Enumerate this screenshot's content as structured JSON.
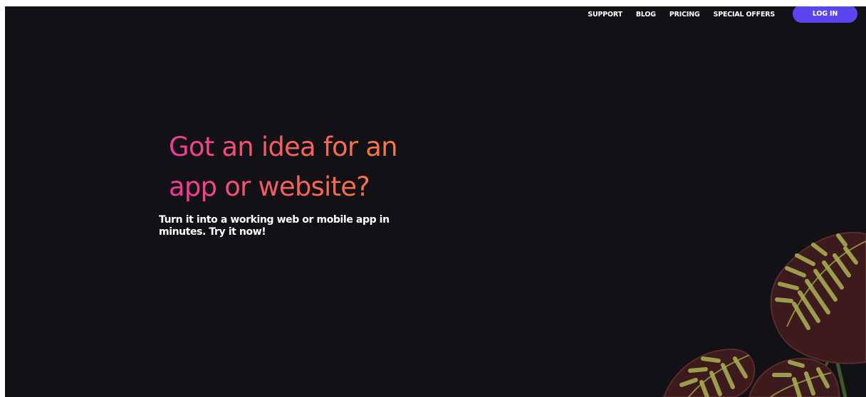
{
  "nav": {
    "links": [
      {
        "label": "SUPPORT"
      },
      {
        "label": "BLOG"
      },
      {
        "label": "PRICING"
      },
      {
        "label": "SPECIAL OFFERS"
      }
    ],
    "login_label": "LOG IN"
  },
  "hero": {
    "title": "Got an idea for an app or website?",
    "subtitle": "Turn it into a working web or mobile app in minutes. Try it now!"
  },
  "colors": {
    "background": "#121116",
    "accent_button": "#5b45f0",
    "gradient_start": "#f2389a",
    "gradient_end": "#f58236",
    "leaf_dark": "#3d1a1c",
    "leaf_stripe": "#a7ab52"
  },
  "icons": [
    "calathea-plant-illustration"
  ]
}
